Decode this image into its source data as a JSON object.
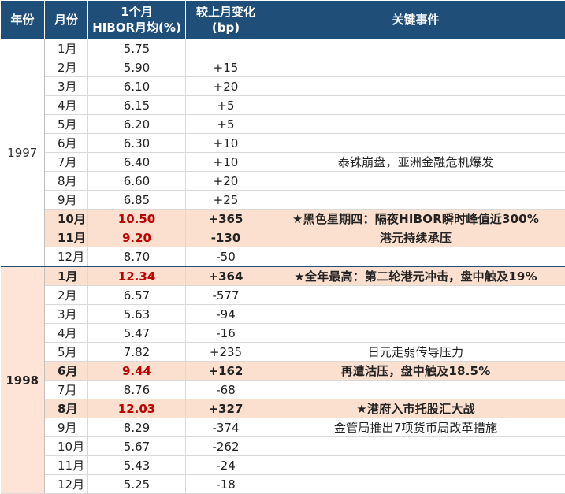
{
  "header": {
    "year": "年份",
    "month": "月份",
    "rate_line1": "1个月",
    "rate_line2": "HIBOR月均(%)",
    "change_line1": "较上月变化",
    "change_line2": "(bp)",
    "event": "关键事件"
  },
  "groups": [
    {
      "year": "1997",
      "rows": [
        {
          "month": "1月",
          "rate": "5.75",
          "change": "",
          "event": "",
          "highlight": false
        },
        {
          "month": "2月",
          "rate": "5.90",
          "change": "+15",
          "event": "",
          "highlight": false
        },
        {
          "month": "3月",
          "rate": "6.10",
          "change": "+20",
          "event": "",
          "highlight": false
        },
        {
          "month": "4月",
          "rate": "6.15",
          "change": "+5",
          "event": "",
          "highlight": false
        },
        {
          "month": "5月",
          "rate": "6.20",
          "change": "+5",
          "event": "",
          "highlight": false
        },
        {
          "month": "6月",
          "rate": "6.30",
          "change": "+10",
          "event": "",
          "highlight": false
        },
        {
          "month": "7月",
          "rate": "6.40",
          "change": "+10",
          "event": "泰铢崩盘，亚洲金融危机爆发",
          "highlight": false
        },
        {
          "month": "8月",
          "rate": "6.60",
          "change": "+20",
          "event": "",
          "highlight": false
        },
        {
          "month": "9月",
          "rate": "6.85",
          "change": "+25",
          "event": "",
          "highlight": false
        },
        {
          "month": "10月",
          "rate": "10.50",
          "change": "+365",
          "event": "★黑色星期四：隔夜HIBOR瞬时峰值近300%",
          "highlight": true
        },
        {
          "month": "11月",
          "rate": "9.20",
          "change": "-130",
          "event": "港元持续承压",
          "highlight": true
        },
        {
          "month": "12月",
          "rate": "8.70",
          "change": "-50",
          "event": "",
          "highlight": false
        }
      ]
    },
    {
      "year": "1998",
      "rows": [
        {
          "month": "1月",
          "rate": "12.34",
          "change": "+364",
          "event": "★全年最高：第二轮港元冲击，盘中触及19%",
          "highlight": true
        },
        {
          "month": "2月",
          "rate": "6.57",
          "change": "-577",
          "event": "",
          "highlight": false
        },
        {
          "month": "3月",
          "rate": "5.63",
          "change": "-94",
          "event": "",
          "highlight": false
        },
        {
          "month": "4月",
          "rate": "5.47",
          "change": "-16",
          "event": "",
          "highlight": false
        },
        {
          "month": "5月",
          "rate": "7.82",
          "change": "+235",
          "event": "日元走弱传导压力",
          "highlight": false
        },
        {
          "month": "6月",
          "rate": "9.44",
          "change": "+162",
          "event": "再遭沽压，盘中触及18.5%",
          "highlight": true
        },
        {
          "month": "7月",
          "rate": "8.76",
          "change": "-68",
          "event": "",
          "highlight": false
        },
        {
          "month": "8月",
          "rate": "12.03",
          "change": "+327",
          "event": "★港府入市托股汇大战",
          "highlight": true
        },
        {
          "month": "9月",
          "rate": "8.29",
          "change": "-374",
          "event": "金管局推出7项货币局改革措施",
          "highlight": false
        },
        {
          "month": "10月",
          "rate": "5.67",
          "change": "-262",
          "event": "",
          "highlight": false
        },
        {
          "month": "11月",
          "rate": "5.43",
          "change": "-24",
          "event": "",
          "highlight": false
        },
        {
          "month": "12月",
          "rate": "5.25",
          "change": "-18",
          "event": "",
          "highlight": false
        }
      ]
    }
  ]
}
